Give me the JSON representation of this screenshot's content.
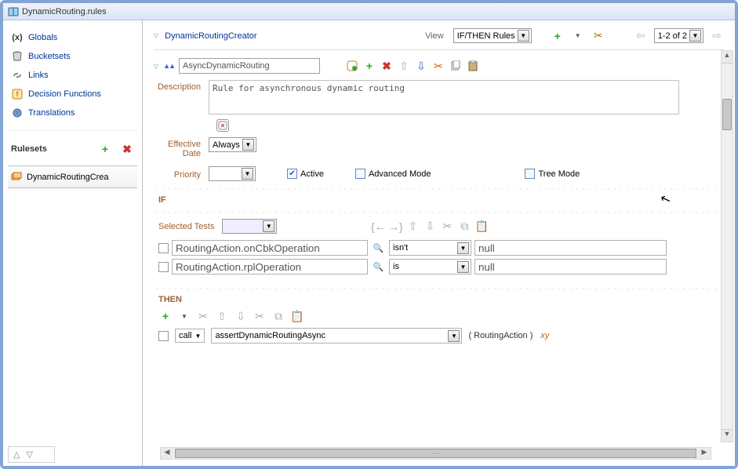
{
  "title": "DynamicRouting.rules",
  "sidebar": {
    "items": [
      {
        "label": "Globals",
        "icon": "(x)"
      },
      {
        "label": "Bucketsets",
        "icon": "bucket"
      },
      {
        "label": "Links",
        "icon": "link"
      },
      {
        "label": "Decision Functions",
        "icon": "func"
      },
      {
        "label": "Translations",
        "icon": "globe"
      }
    ],
    "rulesets_title": "Rulesets",
    "ruleset_item": "DynamicRoutingCrea"
  },
  "header": {
    "title": "DynamicRoutingCreator",
    "view_label": "View",
    "view_value": "IF/THEN Rules",
    "pager": "1-2 of 2"
  },
  "rule": {
    "name": "AsyncDynamicRouting",
    "description_label": "Description",
    "description_value": "Rule for asynchronous dynamic routing",
    "effective_date_label": "Effective Date",
    "effective_date_value": "Always",
    "priority_label": "Priority",
    "priority_value": "",
    "active_label": "Active",
    "active_checked": true,
    "advanced_label": "Advanced Mode",
    "advanced_checked": false,
    "tree_label": "Tree Mode",
    "tree_checked": false
  },
  "if_section": {
    "title": "IF",
    "selected_tests_label": "Selected Tests",
    "rows": [
      {
        "lhs": "RoutingAction.onCbkOperation",
        "op": "isn't",
        "rhs": "null"
      },
      {
        "lhs": "RoutingAction.rplOperation",
        "op": "is",
        "rhs": "null"
      }
    ]
  },
  "then_section": {
    "title": "THEN",
    "call_label": "call",
    "action_value": "assertDynamicRoutingAsync",
    "paren_text": "( RoutingAction )"
  }
}
